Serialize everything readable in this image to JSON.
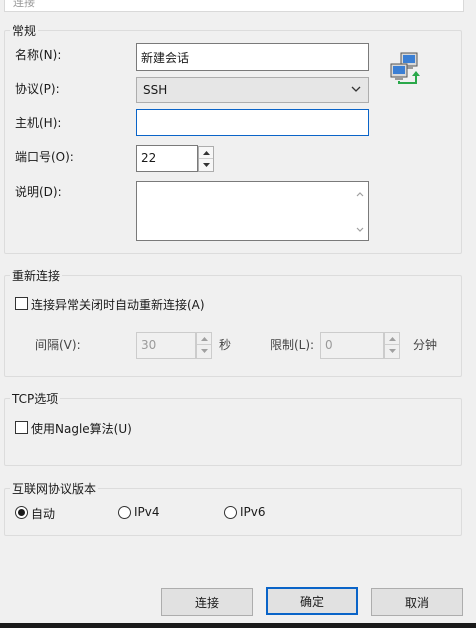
{
  "window": {
    "tab_title": "连接"
  },
  "general": {
    "title": "常规",
    "name_label": "名称(N):",
    "name_value": "新建会话",
    "protocol_label": "协议(P):",
    "protocol_value": "SSH",
    "host_label": "主机(H):",
    "host_value": "",
    "port_label": "端口号(O):",
    "port_value": "22",
    "desc_label": "说明(D):",
    "desc_value": "",
    "icon": "network-computers-icon"
  },
  "reconnect": {
    "title": "重新连接",
    "auto_label": "连接异常关闭时自动重新连接(A)",
    "auto_checked": false,
    "interval_label": "间隔(V):",
    "interval_value": "30",
    "interval_unit": "秒",
    "limit_label": "限制(L):",
    "limit_value": "0",
    "limit_unit": "分钟"
  },
  "tcp": {
    "title": "TCP选项",
    "nagle_label": "使用Nagle算法(U)",
    "nagle_checked": false
  },
  "ip_version": {
    "title": "互联网协议版本",
    "options": [
      {
        "label": "自动",
        "selected": true
      },
      {
        "label": "IPv4",
        "selected": false
      },
      {
        "label": "IPv6",
        "selected": false
      }
    ]
  },
  "buttons": {
    "connect": "连接",
    "ok": "确定",
    "cancel": "取消"
  },
  "colors": {
    "accent": "#0a64c8",
    "background": "#f0f0f0"
  }
}
